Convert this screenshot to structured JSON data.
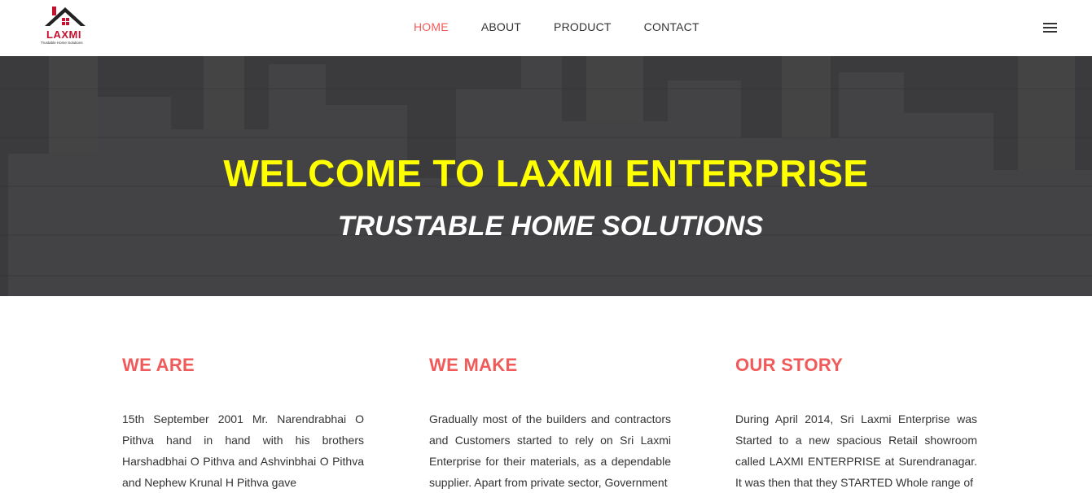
{
  "logo": {
    "name": "LAXMI",
    "tagline": "Trustable Home Solutions"
  },
  "nav": {
    "items": [
      "HOME",
      "ABOUT",
      "PRODUCT",
      "CONTACT"
    ],
    "active": "HOME"
  },
  "hero": {
    "title": "WELCOME TO LAXMI ENTERPRISE",
    "subtitle": "TRUSTABLE HOME SOLUTIONS"
  },
  "sections": [
    {
      "heading": "WE ARE",
      "text": "15th September 2001 Mr. Narendrabhai O Pithva hand in hand with his brothers Harshadbhai O Pithva and Ashvinbhai O Pithva and Nephew Krunal H Pithva gave"
    },
    {
      "heading": "WE MAKE",
      "text": "Gradually most of the builders and contractors and Customers started to rely on Sri Laxmi Enterprise for their materials, as a dependable supplier. Apart from private sector, Government"
    },
    {
      "heading": "OUR STORY",
      "text": "During April 2014, Sri Laxmi Enterprise was Started to a new spacious Retail showroom called LAXMI ENTERPRISE at Surendranagar. It was then that they STARTED Whole range of"
    }
  ],
  "colors": {
    "accent": "#f05a5a",
    "hero_title": "#ffff00",
    "hero_bg": "#3a3a3c",
    "logo_red": "#c8102e"
  },
  "icons": {
    "menu": "hamburger-menu-icon",
    "logo_roof": "house-roof-icon"
  }
}
